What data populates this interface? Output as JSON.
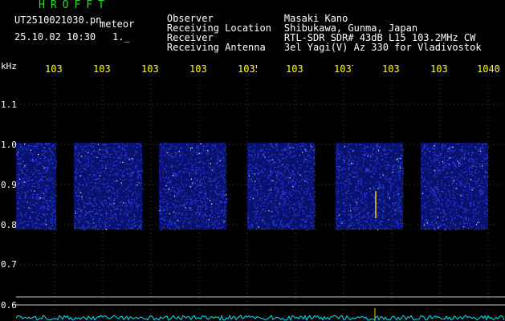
{
  "header": {
    "app_title": "HROFFT",
    "file_name": "UT2510021030.pn",
    "file_tag": "meteor",
    "datetime": "25.10.02 10:30",
    "counter": "1._"
  },
  "info": [
    {
      "key": "Observer",
      "value": "Masaki Kano"
    },
    {
      "key": "Receiving Location",
      "value": "Shibukawa, Gunma, Japan"
    },
    {
      "key": "Receiver",
      "value": "RTL-SDR SDR# 43dB L15 103.2MHz CW"
    },
    {
      "key": "Receiving Antenna",
      "value": "3el Yagi(V) Az 330 for Vladivostok"
    }
  ],
  "axes": {
    "x_unit": "kHz",
    "x_ticks": [
      "103(",
      "103;",
      "103;",
      "103.",
      "1035",
      "103(",
      "1037",
      "103(",
      "103(",
      "1040"
    ],
    "y_ticks": [
      "1.1",
      "1.0",
      "0.9",
      "0.8",
      "0.7",
      "0.6"
    ]
  },
  "colors": {
    "background": "#000000",
    "grid": "#c8c8c8",
    "tick_text": "#ffff00",
    "signal": "#2a3cff",
    "noise_floor": "#00e5ff",
    "meteor_trace": "#ffcc00"
  }
}
